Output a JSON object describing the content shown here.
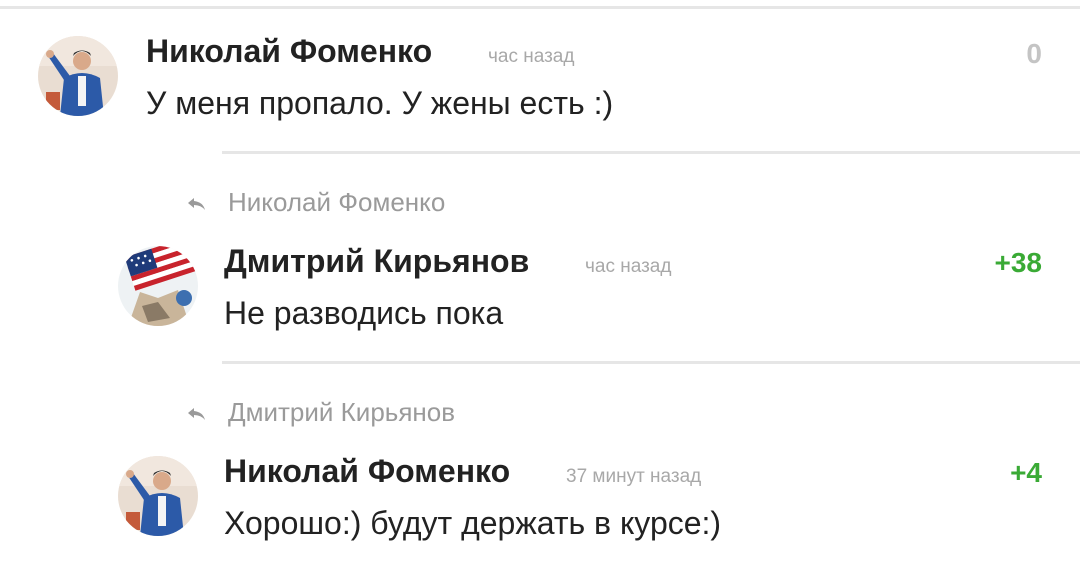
{
  "comments": [
    {
      "author": "Николай Фоменко",
      "time": "час назад",
      "score": "0",
      "text": "У меня пропало. У жены есть :)"
    },
    {
      "reply_to": "Николай Фоменко",
      "author": "Дмитрий Кирьянов",
      "time": "час назад",
      "score": "+38",
      "text": "Не разводись пока"
    },
    {
      "reply_to": "Дмитрий Кирьянов",
      "author": "Николай Фоменко",
      "time": "37 минут назад",
      "score": "+4",
      "text": "Хорошо:) будут держать в курсе:)"
    }
  ],
  "colors": {
    "positive_score": "#3aaa35",
    "zero_score": "#c4c4c4",
    "meta_gray": "#a8a8a8"
  },
  "icons": {
    "reply": "reply-arrow-icon",
    "avatar_nikolai": "man-in-blue-jacket-avatar",
    "avatar_dmitry": "us-flag-avatar"
  }
}
